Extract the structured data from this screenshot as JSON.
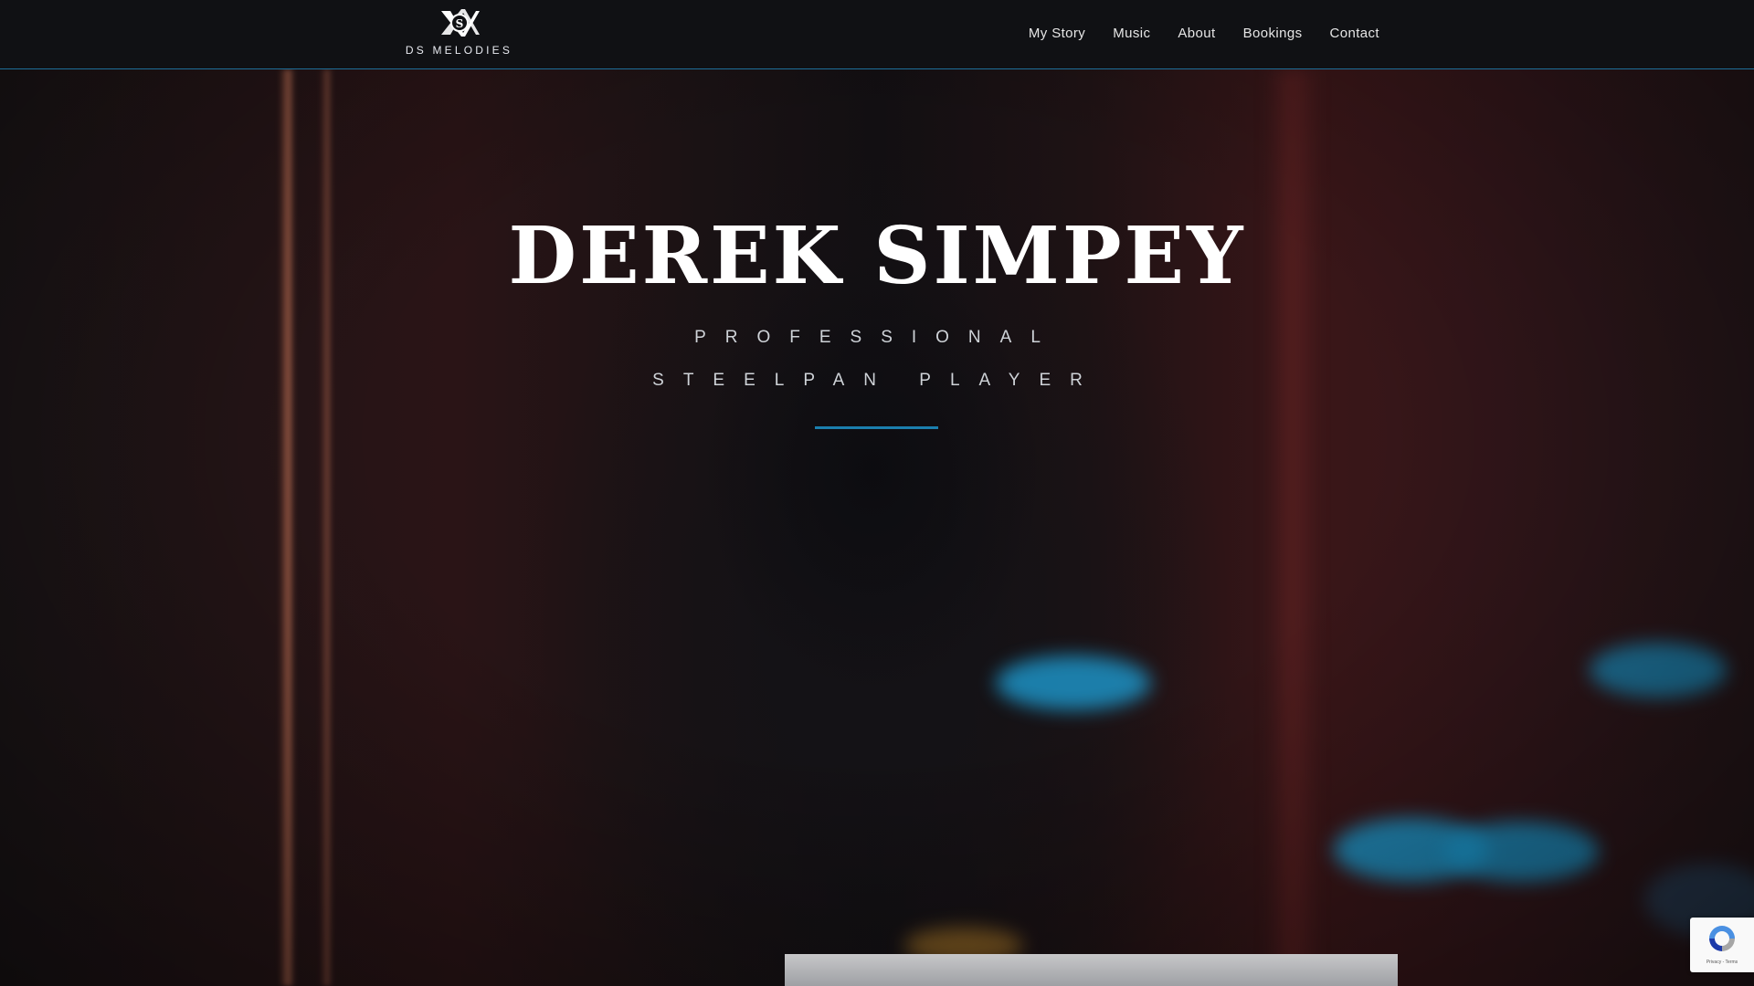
{
  "brand": {
    "name": "DS MELODIES",
    "logo_icon": "ds-monogram-icon"
  },
  "nav": {
    "items": [
      {
        "label": "My Story"
      },
      {
        "label": "Music"
      },
      {
        "label": "About"
      },
      {
        "label": "Bookings"
      },
      {
        "label": "Contact"
      }
    ]
  },
  "hero": {
    "title": "DEREK SIMPEY",
    "subtitle_line1": "PROFESSIONAL",
    "subtitle_line2": "STEELPAN PLAYER",
    "accent_color": "#1b7fae"
  },
  "recaptcha": {
    "icon": "recaptcha-icon",
    "text": "Privacy - Terms"
  }
}
